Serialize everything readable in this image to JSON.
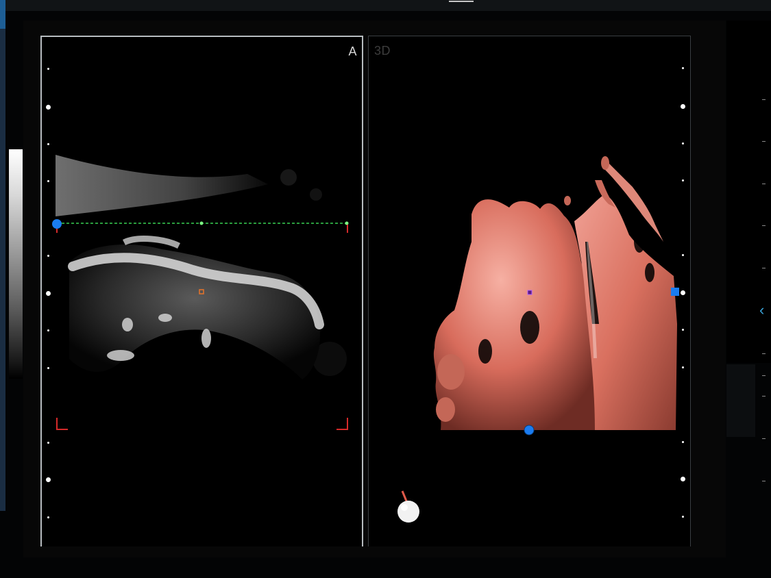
{
  "screen": {
    "background_color": "#030405",
    "accent_color": "#1d5e95"
  },
  "viewports": {
    "a": {
      "label": "A",
      "border_color": "#b7bcc0"
    },
    "render_3d": {
      "label": "3D",
      "render_color": "#e07b6b"
    }
  },
  "overlay": {
    "cut_line_color": "#39d353",
    "roi_corner_color": "#d52a2a",
    "handle_color": "#1a7cf0",
    "center_marker_color": "#e8742a"
  },
  "icons": {
    "orientation": "orientation-sphere-icon",
    "ruler_arrow": "chevron-left-icon",
    "ruler_arrow_glyph": "‹"
  }
}
